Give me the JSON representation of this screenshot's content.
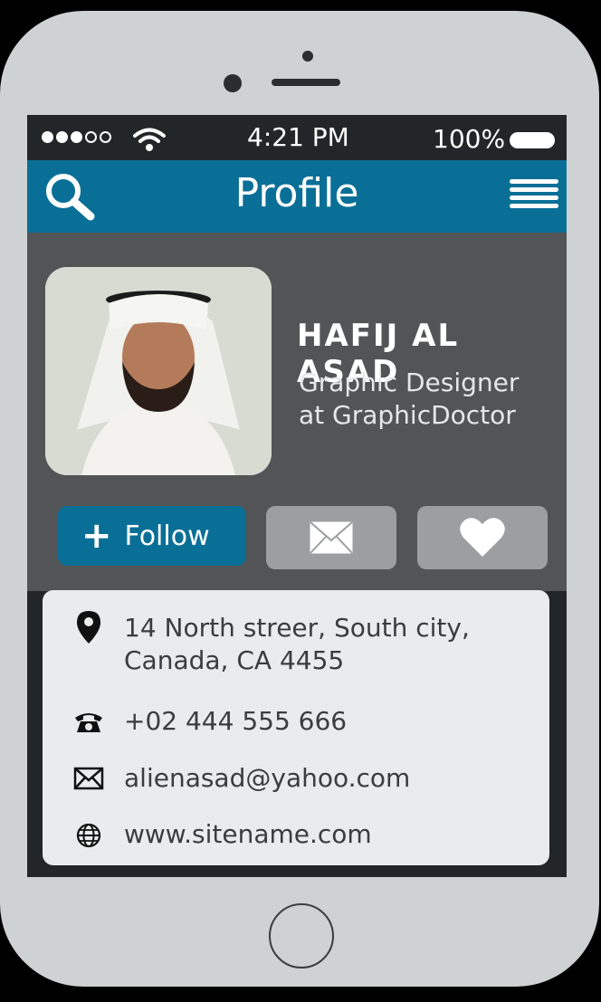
{
  "status_bar": {
    "signal": [
      "filled",
      "filled",
      "filled",
      "empty",
      "empty"
    ],
    "time": "4:21 PM",
    "battery": "100%"
  },
  "header": {
    "title": "Profile",
    "left_icon": "search-icon",
    "right_icon": "menu-icon",
    "color": "#0a6f96"
  },
  "profile": {
    "name": "HAFIJ AL ASAD",
    "role_line1": "Graphic Designer",
    "role_line2": "at GraphicDoctor"
  },
  "actions": {
    "follow_label": "Follow",
    "mail_icon": "envelope-icon",
    "like_icon": "heart-icon"
  },
  "contact": {
    "address_line1": "14 North streer, South city,",
    "address_line2": "Canada, CA 4455",
    "phone": "+02 444 555 666",
    "email": "alienasad@yahoo.com",
    "website": "www.sitename.com"
  }
}
